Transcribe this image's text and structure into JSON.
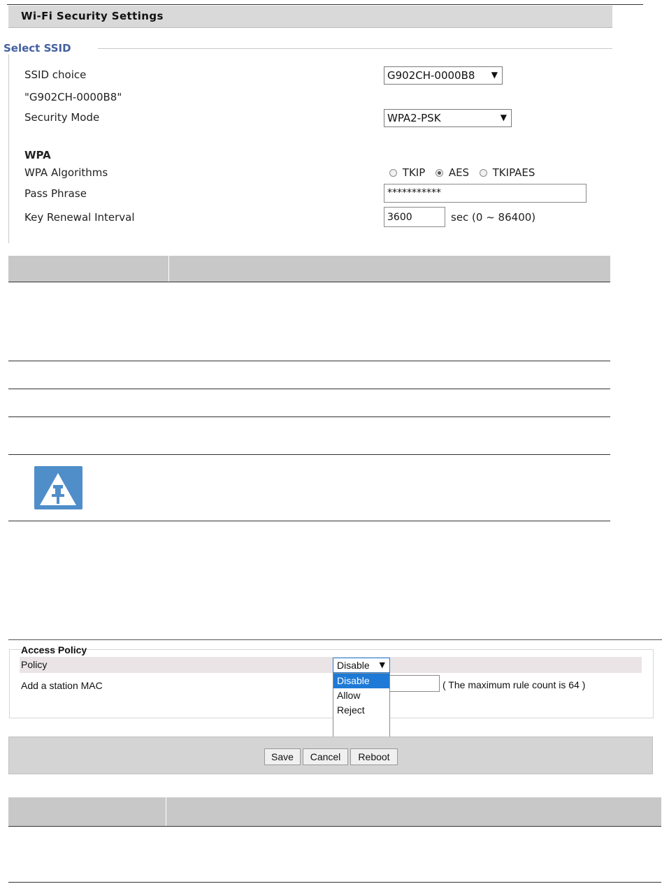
{
  "wifi_security": {
    "title": "Wi-Fi Security Settings",
    "select_ssid_legend": "Select SSID",
    "ssid_choice_label": "SSID choice",
    "ssid_choice_value": "G902CH-0000B8",
    "ssid_name_display": "\"G902CH-0000B8\"",
    "security_mode_label": "Security Mode",
    "security_mode_value": "WPA2-PSK",
    "wpa_heading": "WPA",
    "wpa_algorithms_label": "WPA Algorithms",
    "algorithms": [
      {
        "label": "TKIP",
        "selected": false
      },
      {
        "label": "AES",
        "selected": true
      },
      {
        "label": "TKIPAES",
        "selected": false
      }
    ],
    "pass_phrase_label": "Pass Phrase",
    "pass_phrase_value": "***********",
    "key_renewal_label": "Key Renewal Interval",
    "key_renewal_value": "3600",
    "key_renewal_unit": "sec   (0 ~ 86400)"
  },
  "note": {
    "icon": "pushpin-note-icon",
    "icon_color": "#4f8ec9"
  },
  "access_policy": {
    "heading": "Access Policy",
    "policy_label": "Policy",
    "policy_value": "Disable",
    "policy_options": [
      "Disable",
      "Allow",
      "Reject"
    ],
    "add_mac_label": "Add a station MAC",
    "max_rule_note": "( The maximum rule count is 64 )"
  },
  "buttons": {
    "save": "Save",
    "cancel": "Cancel",
    "reboot": "Reboot"
  },
  "colors": {
    "legend_blue": "#4560a0",
    "selected_option": "#1e7ad6",
    "header_gray": "#d9d9d9"
  }
}
